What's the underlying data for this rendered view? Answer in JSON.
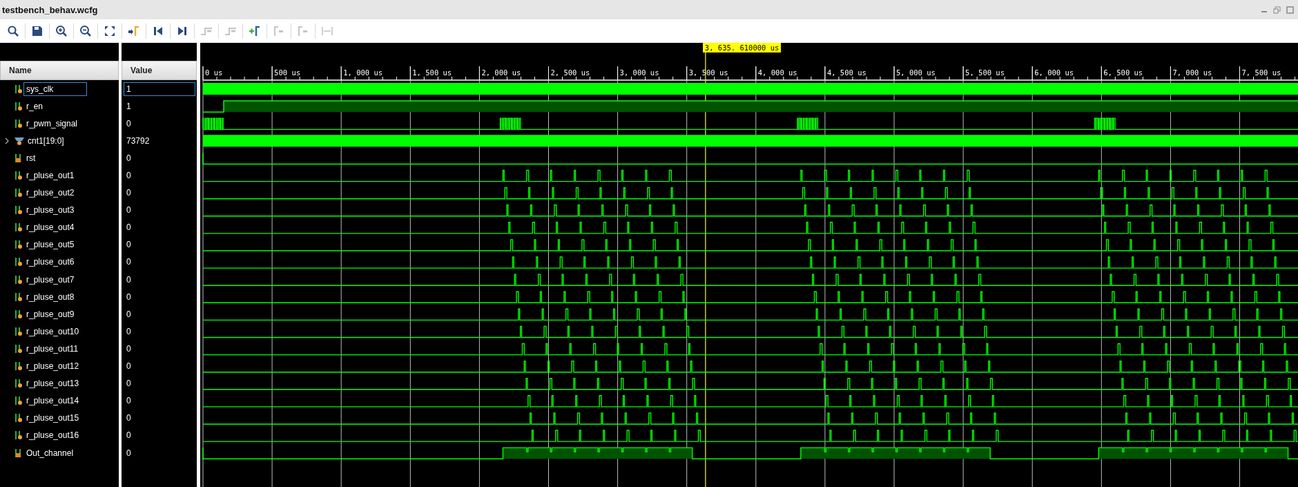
{
  "window": {
    "title": "testbench_behav.wcfg"
  },
  "toolbar": [
    {
      "kind": "search",
      "disabled": false
    },
    {
      "kind": "save",
      "disabled": false
    },
    {
      "kind": "zoom-in",
      "disabled": false
    },
    {
      "kind": "zoom-out",
      "disabled": false
    },
    {
      "kind": "zoom-fit",
      "disabled": false
    },
    {
      "kind": "go-to-cursor",
      "disabled": false
    },
    {
      "kind": "go-to-start",
      "disabled": false
    },
    {
      "kind": "go-to-end",
      "disabled": false
    },
    {
      "kind": "previous-transition",
      "disabled": true
    },
    {
      "kind": "next-transition",
      "disabled": true
    },
    {
      "kind": "add-marker",
      "disabled": false
    },
    {
      "kind": "previous-marker",
      "disabled": true
    },
    {
      "kind": "next-marker",
      "disabled": true
    },
    {
      "kind": "swap-cursors",
      "disabled": true
    }
  ],
  "columns": {
    "name": "Name",
    "value": "Value"
  },
  "cursor": {
    "label": "3, 635. 610000 us"
  },
  "time_ruler": {
    "labels": [
      "0 us",
      "500 us",
      "1, 000 us",
      "1, 500 us",
      "2, 000 us",
      "2, 500 us",
      "3, 000 us",
      "3, 500 us",
      "4, 000 us",
      "4, 500 us",
      "5, 000 us",
      "5, 500 us",
      "6, 000 us",
      "6, 500 us",
      "7, 000 us",
      "7, 500 us"
    ]
  },
  "signals": [
    {
      "name": "sys_clk",
      "value": "1",
      "kind": "clock",
      "selected": true
    },
    {
      "name": "r_en",
      "value": "1",
      "kind": "enable",
      "selected": false
    },
    {
      "name": "r_pwm_signal",
      "value": "0",
      "kind": "pwm",
      "selected": false
    },
    {
      "name": "cnt1[19:0]",
      "value": "73792",
      "kind": "bus",
      "selected": false,
      "expanded": false
    },
    {
      "name": "rst",
      "value": "0",
      "kind": "reset",
      "selected": false
    },
    {
      "name": "r_pluse_out1",
      "value": "0",
      "kind": "pulse",
      "selected": false
    },
    {
      "name": "r_pluse_out2",
      "value": "0",
      "kind": "pulse",
      "selected": false
    },
    {
      "name": "r_pluse_out3",
      "value": "0",
      "kind": "pulse",
      "selected": false
    },
    {
      "name": "r_pluse_out4",
      "value": "0",
      "kind": "pulse",
      "selected": false
    },
    {
      "name": "r_pluse_out5",
      "value": "0",
      "kind": "pulse",
      "selected": false
    },
    {
      "name": "r_pluse_out6",
      "value": "0",
      "kind": "pulse",
      "selected": false
    },
    {
      "name": "r_pluse_out7",
      "value": "0",
      "kind": "pulse",
      "selected": false
    },
    {
      "name": "r_pluse_out8",
      "value": "0",
      "kind": "pulse",
      "selected": false
    },
    {
      "name": "r_pluse_out9",
      "value": "0",
      "kind": "pulse",
      "selected": false
    },
    {
      "name": "r_pluse_out10",
      "value": "0",
      "kind": "pulse",
      "selected": false
    },
    {
      "name": "r_pluse_out11",
      "value": "0",
      "kind": "pulse",
      "selected": false
    },
    {
      "name": "r_pluse_out12",
      "value": "0",
      "kind": "pulse",
      "selected": false
    },
    {
      "name": "r_pluse_out13",
      "value": "0",
      "kind": "pulse",
      "selected": false
    },
    {
      "name": "r_pluse_out14",
      "value": "0",
      "kind": "pulse",
      "selected": false
    },
    {
      "name": "r_pluse_out15",
      "value": "0",
      "kind": "pulse",
      "selected": false
    },
    {
      "name": "r_pluse_out16",
      "value": "0",
      "kind": "pulse",
      "selected": false
    },
    {
      "name": "Out_channel",
      "value": "0",
      "kind": "channel",
      "selected": false
    }
  ]
}
